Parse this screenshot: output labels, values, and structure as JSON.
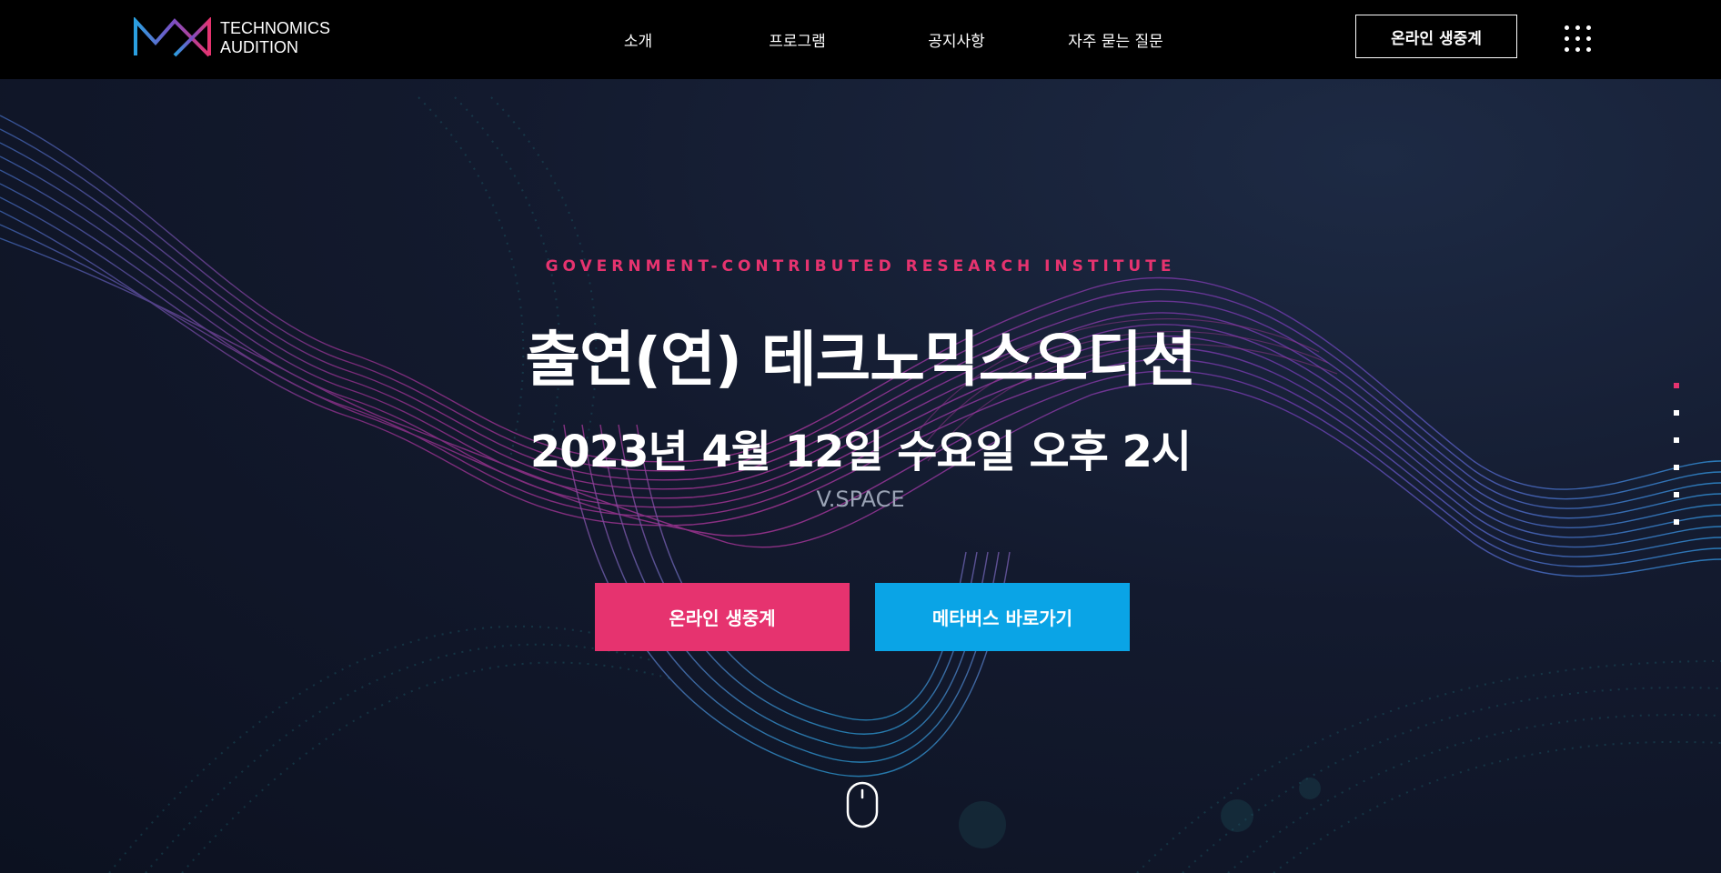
{
  "header": {
    "logo_line1": "TECHNOMICS",
    "logo_line2": "AUDITION",
    "nav": [
      {
        "label": "소개"
      },
      {
        "label": "프로그램"
      },
      {
        "label": "공지사항"
      },
      {
        "label": "자주 묻는 질문"
      }
    ],
    "live_button": "온라인 생중계",
    "menu_icon": "grid-menu-icon"
  },
  "hero": {
    "subtitle": "GOVERNMENT-CONTRIBUTED RESEARCH INSTITUTE",
    "title": "출연(연) 테크노믹스오디션",
    "date": "2023년 4월 12일 수요일 오후 2시",
    "venue": "V.SPACE",
    "live_button": "온라인 생중계",
    "metaverse_button": "메타버스 바로가기",
    "scroll_icon": "mouse-scroll-icon",
    "slide_count": 6,
    "active_slide": 1
  },
  "colors": {
    "accent_pink": "#e6336f",
    "accent_blue": "#0aa4e6",
    "header_bg": "#000000",
    "hero_bg": "#131a2e"
  }
}
